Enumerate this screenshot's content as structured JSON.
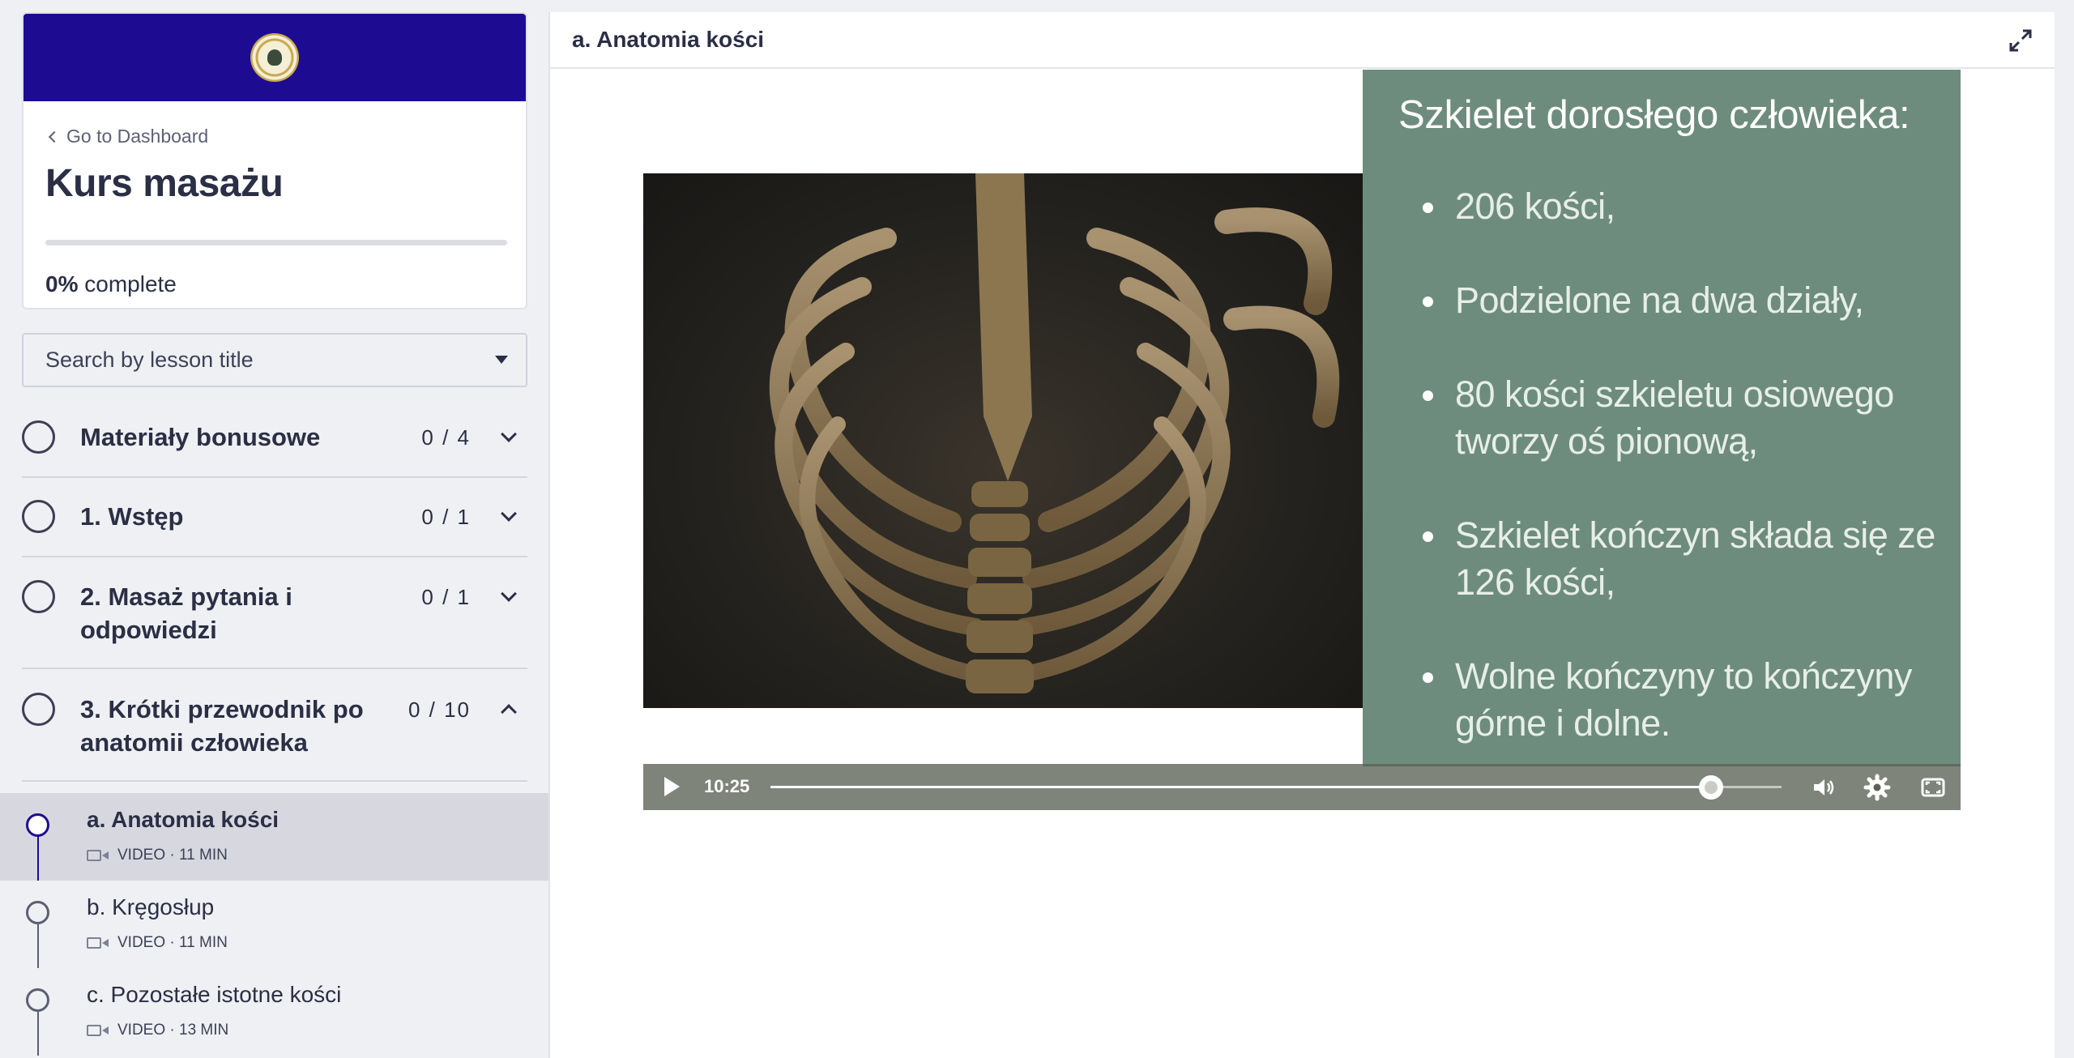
{
  "sidebar": {
    "back_link": "Go to Dashboard",
    "course_title": "Kurs masażu",
    "progress_percent": 0,
    "progress_value": "0%",
    "progress_suffix": "complete",
    "search_placeholder": "Search by lesson title",
    "sections": [
      {
        "title": "Materiały bonusowe",
        "count": "0 / 4",
        "expanded": false
      },
      {
        "title": "1. Wstęp",
        "count": "0 / 1",
        "expanded": false
      },
      {
        "title": "2. Masaż pytania i odpowiedzi",
        "count": "0 / 1",
        "expanded": false
      },
      {
        "title": "3. Krótki przewodnik po anatomii człowieka",
        "count": "0 / 10",
        "expanded": true
      }
    ],
    "lessons": [
      {
        "title": "a. Anatomia kości",
        "meta": "VIDEO · 11 MIN",
        "active": true
      },
      {
        "title": "b. Kręgosłup",
        "meta": "VIDEO · 11 MIN",
        "active": false
      },
      {
        "title": "c. Pozostałe istotne kości",
        "meta": "VIDEO · 13 MIN",
        "active": false
      }
    ]
  },
  "main": {
    "lesson_title": "a. Anatomia kości",
    "video": {
      "slide_heading": "Szkielet dorosłego człowieka:",
      "slide_points": [
        "206 kości,",
        "Podzielone na dwa działy,",
        "80  kości szkieletu osiowego tworzy oś pionową,",
        "Szkielet kończyn składa się ze 126 kości,",
        "Wolne kończyny to kończyny górne i dolne."
      ],
      "time": "10:25",
      "progress_fraction": 0.93
    }
  },
  "colors": {
    "brand": "#1d0c91",
    "slide_bg": "#6e8c7d",
    "page_bg": "#eef0f3"
  },
  "icons": {
    "logo": "crest-logo",
    "expand": "expand-icon",
    "play": "play-icon",
    "volume": "volume-icon",
    "settings": "gear-icon",
    "fullscreen": "fullscreen-icon"
  }
}
